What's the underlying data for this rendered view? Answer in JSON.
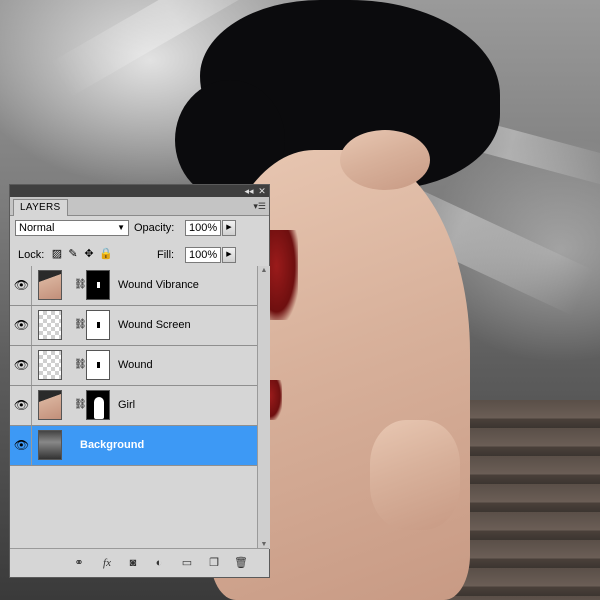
{
  "panel": {
    "tab_label": "LAYERS",
    "blend_mode": "Normal",
    "opacity_label": "Opacity:",
    "opacity_value": "100%",
    "lock_label": "Lock:",
    "fill_label": "Fill:",
    "fill_value": "100%"
  },
  "layers": [
    {
      "name": "Wound Vibrance",
      "visible": true,
      "selected": false
    },
    {
      "name": "Wound Screen",
      "visible": true,
      "selected": false
    },
    {
      "name": "Wound",
      "visible": true,
      "selected": false
    },
    {
      "name": "Girl",
      "visible": true,
      "selected": false
    },
    {
      "name": "Background",
      "visible": true,
      "selected": true
    }
  ],
  "bottom_icons": [
    "link-layers-icon",
    "fx-icon",
    "add-mask-icon",
    "adjustment-layer-icon",
    "new-group-icon",
    "new-layer-icon",
    "trash-icon"
  ],
  "colors": {
    "selection": "#3d99f5",
    "panel": "#d6d6d6"
  }
}
